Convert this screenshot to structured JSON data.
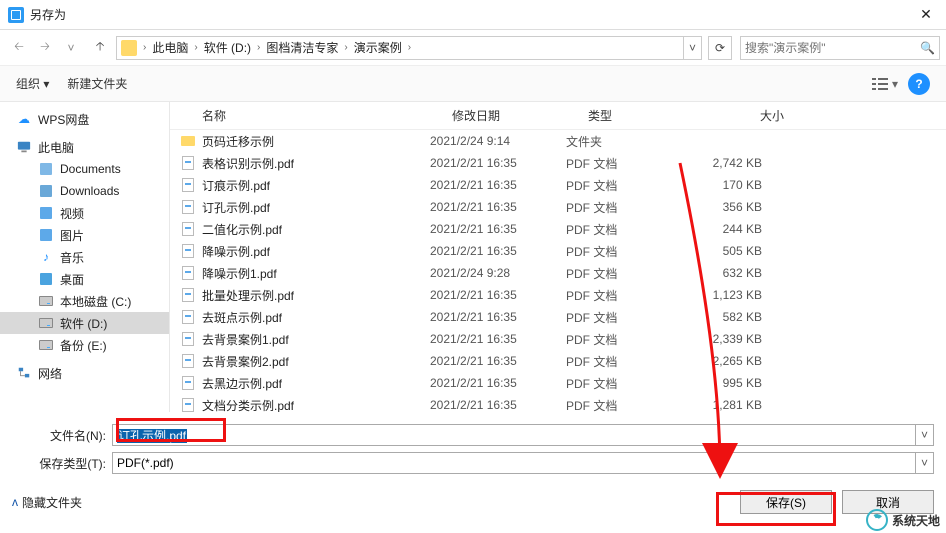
{
  "window": {
    "title": "另存为",
    "close_glyph": "✕"
  },
  "nav": {
    "breadcrumb": [
      "此电脑",
      "软件 (D:)",
      "图档清洁专家",
      "演示案例"
    ],
    "search_placeholder": "搜索\"演示案例\""
  },
  "toolbar": {
    "organize": "组织 ▾",
    "new_folder": "新建文件夹",
    "help_glyph": "?"
  },
  "columns": {
    "name": "名称",
    "date": "修改日期",
    "type": "类型",
    "size": "大小"
  },
  "sidebar": {
    "wps": "WPS网盘",
    "pc": "此电脑",
    "documents": "Documents",
    "downloads": "Downloads",
    "videos": "视频",
    "pictures": "图片",
    "music": "音乐",
    "desktop": "桌面",
    "disk_c": "本地磁盘 (C:)",
    "disk_d": "软件 (D:)",
    "disk_e": "备份 (E:)",
    "network": "网络"
  },
  "files": [
    {
      "name": "页码迁移示例",
      "date": "2021/2/24 9:14",
      "type": "文件夹",
      "size": "",
      "isFolder": true
    },
    {
      "name": "表格识别示例.pdf",
      "date": "2021/2/21 16:35",
      "type": "PDF 文档",
      "size": "2,742 KB"
    },
    {
      "name": "订痕示例.pdf",
      "date": "2021/2/21 16:35",
      "type": "PDF 文档",
      "size": "170 KB"
    },
    {
      "name": "订孔示例.pdf",
      "date": "2021/2/21 16:35",
      "type": "PDF 文档",
      "size": "356 KB"
    },
    {
      "name": "二值化示例.pdf",
      "date": "2021/2/21 16:35",
      "type": "PDF 文档",
      "size": "244 KB"
    },
    {
      "name": "降噪示例.pdf",
      "date": "2021/2/21 16:35",
      "type": "PDF 文档",
      "size": "505 KB"
    },
    {
      "name": "降噪示例1.pdf",
      "date": "2021/2/24 9:28",
      "type": "PDF 文档",
      "size": "632 KB"
    },
    {
      "name": "批量处理示例.pdf",
      "date": "2021/2/21 16:35",
      "type": "PDF 文档",
      "size": "1,123 KB"
    },
    {
      "name": "去斑点示例.pdf",
      "date": "2021/2/21 16:35",
      "type": "PDF 文档",
      "size": "582 KB"
    },
    {
      "name": "去背景案例1.pdf",
      "date": "2021/2/21 16:35",
      "type": "PDF 文档",
      "size": "2,339 KB"
    },
    {
      "name": "去背景案例2.pdf",
      "date": "2021/2/21 16:35",
      "type": "PDF 文档",
      "size": "2,265 KB"
    },
    {
      "name": "去黑边示例.pdf",
      "date": "2021/2/21 16:35",
      "type": "PDF 文档",
      "size": "995 KB"
    },
    {
      "name": "文档分类示例.pdf",
      "date": "2021/2/21 16:35",
      "type": "PDF 文档",
      "size": "1,281 KB"
    }
  ],
  "fields": {
    "filename_label": "文件名(N):",
    "filename_value": "订孔示例.pdf",
    "savetype_label": "保存类型(T):",
    "savetype_value": "PDF(*.pdf)"
  },
  "actions": {
    "hide_folders": "隐藏文件夹",
    "save": "保存(S)",
    "cancel": "取消"
  },
  "watermark": "系统天地"
}
